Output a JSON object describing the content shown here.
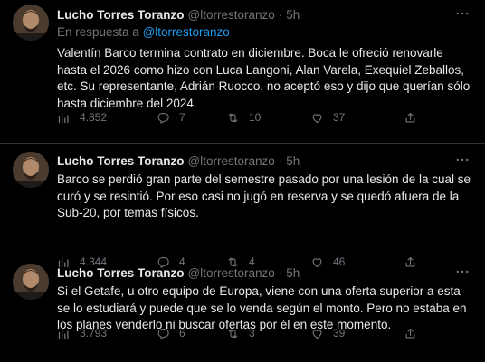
{
  "tweets": [
    {
      "author_name": "Lucho Torres Toranzo",
      "handle": "@ltorrestoranzo",
      "separator": "·",
      "time": "5h",
      "reply_prefix": "En respuesta a",
      "reply_mention": "@ltorrestoranzo",
      "text": "Valentín Barco termina contrato en diciembre. Boca le ofreció renovarle hasta el 2026 como hizo con Luca Langoni, Alan Varela, Exequiel Zeballos, etc. Su representante, Adrián Ruocco, no aceptó eso y dijo que querían sólo hasta diciembre del 2024.",
      "views": "4.852",
      "replies": "7",
      "retweets": "10",
      "likes": "37"
    },
    {
      "author_name": "Lucho Torres Toranzo",
      "handle": "@ltorrestoranzo",
      "separator": "·",
      "time": "5h",
      "text": "Barco se perdió gran parte del semestre pasado por una lesión de la cual se curó y se resintió. Por eso casi no jugó en reserva y se quedó afuera de la Sub-20, por temas físicos.",
      "views": "4.344",
      "replies": "4",
      "retweets": "4",
      "likes": "46"
    },
    {
      "author_name": "Lucho Torres Toranzo",
      "handle": "@ltorrestoranzo",
      "separator": "·",
      "time": "5h",
      "text": "Si el Getafe, u otro equipo de Europa, viene con una oferta superior a esta se lo estudiará y puede que se lo venda según el monto. Pero no estaba en los planes venderlo ni buscar ofertas por él en este momento.",
      "views": "3.793",
      "replies": "6",
      "retweets": "3",
      "likes": "39"
    }
  ],
  "colors": {
    "background": "#000000",
    "text": "#e7e9ea",
    "muted": "#71767b",
    "accent": "#1d9bf0",
    "divider": "#2f3336"
  },
  "icons": [
    "more-icon",
    "views-icon",
    "reply-icon",
    "retweet-icon",
    "like-icon",
    "share-icon"
  ]
}
